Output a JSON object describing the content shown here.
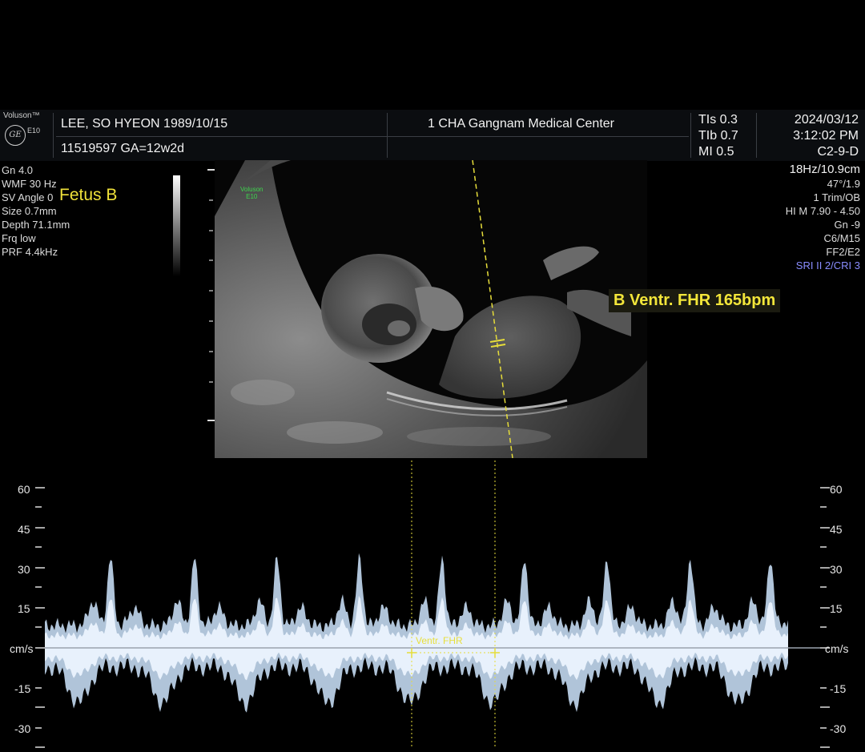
{
  "brand": {
    "name": "Voluson™",
    "model": "E10",
    "logo_text": "GE"
  },
  "header": {
    "patient_name": "LEE, SO HYEON  1989/10/15",
    "patient_id_ga": "11519597  GA=12w2d",
    "institution": "1 CHA Gangnam Medical Center",
    "tis": "TIs  0.3",
    "tib": "TIb  0.7",
    "mi": "MI  0.5",
    "date": "2024/03/12",
    "time": "3:12:02 PM",
    "probe": "C2-9-D"
  },
  "left_params": [
    "Gn  4.0",
    "WMF 30 Hz",
    "SV Angle  0",
    "Size  0.7mm",
    "Depth 71.1mm",
    "Frq low",
    "PRF  4.4kHz"
  ],
  "right_params": [
    "18Hz/10.9cm",
    "47°/1.9",
    "1 Trim/OB",
    "HI M  7.90 - 4.50",
    "Gn  -9",
    "C6/M15",
    "FF2/E2"
  ],
  "sri_label": "SRI II 2/CRI 3",
  "fetus_label": "Fetus B",
  "image_logo": {
    "name": "Voluson",
    "model": "E10"
  },
  "measurement": {
    "label": "B Ventr. FHR 165bpm"
  },
  "doppler": {
    "unit": "cm/s",
    "ticks": [
      "60",
      "45",
      "30",
      "15",
      "cm/s",
      "-15",
      "-30"
    ],
    "cursor_label": "Ventr. FHR",
    "baseline_color": "#9aa3ad",
    "waveform_color": "#cfe6ff"
  }
}
